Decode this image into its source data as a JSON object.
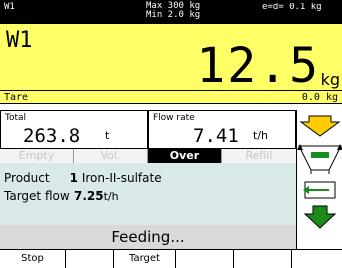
{
  "topbar": {
    "scale_id": "W1",
    "max_text": "Max 300 kg",
    "min_text": "Min 2.0 kg",
    "division_text": "e=d= 0.1 kg"
  },
  "main": {
    "scale_label": "W1",
    "weight": "12.5",
    "weight_unit": "kg",
    "tare_label": "Tare",
    "tare_value": "0.0 kg"
  },
  "totals": {
    "total_label": "Total",
    "total_value": "263.8",
    "total_unit": "t",
    "flow_label": "Flow rate",
    "flow_value": "7.41",
    "flow_unit": "t/h"
  },
  "status": {
    "items": [
      "Empty",
      "Vol.",
      "Over",
      "Refill"
    ],
    "active_index": 2
  },
  "info": {
    "product_label": "Product",
    "product_num": "1",
    "product_name": "Iron-II-sulfate",
    "target_label": "Target flow",
    "target_value": "7.25",
    "target_unit": "t/h"
  },
  "state_text": "Feeding...",
  "softkeys": [
    "Stop",
    "",
    "Target",
    "",
    "",
    ""
  ],
  "colors": {
    "accent_yellow": "#ffff66",
    "arrow_yellow": "#ffcc00",
    "arrow_green": "#1a8a1a"
  }
}
